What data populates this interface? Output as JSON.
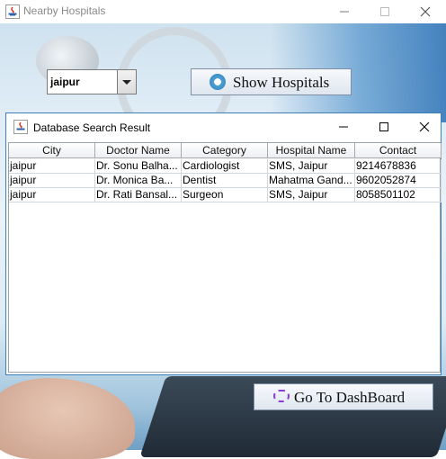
{
  "window": {
    "title": "Nearby Hospitals"
  },
  "controls": {
    "city_combo": {
      "selected": "jaipur"
    },
    "show_button": {
      "label": "Show Hospitals",
      "icon": "hospital-icon"
    },
    "dashboard_button": {
      "label": "Go To DashBoard",
      "icon": "dashboard-icon"
    }
  },
  "dialog": {
    "title": "Database Search Result",
    "table": {
      "columns": [
        "City",
        "Doctor Name",
        "Category",
        "Hospital Name",
        "Contact"
      ],
      "rows": [
        [
          "jaipur",
          "Dr. Sonu Balha...",
          "Cardiologist",
          "SMS, Jaipur",
          "9214678836"
        ],
        [
          "jaipur",
          "Dr. Monica  Ba...",
          "Dentist",
          "Mahatma Gand...",
          "9602052874"
        ],
        [
          "jaipur",
          "Dr. Rati Bansal...",
          "Surgeon",
          "SMS, Jaipur",
          "8058501102"
        ]
      ]
    }
  },
  "colors": {
    "dialog_border": "#3f7fb8",
    "accent_purple": "#8a3fd0"
  }
}
